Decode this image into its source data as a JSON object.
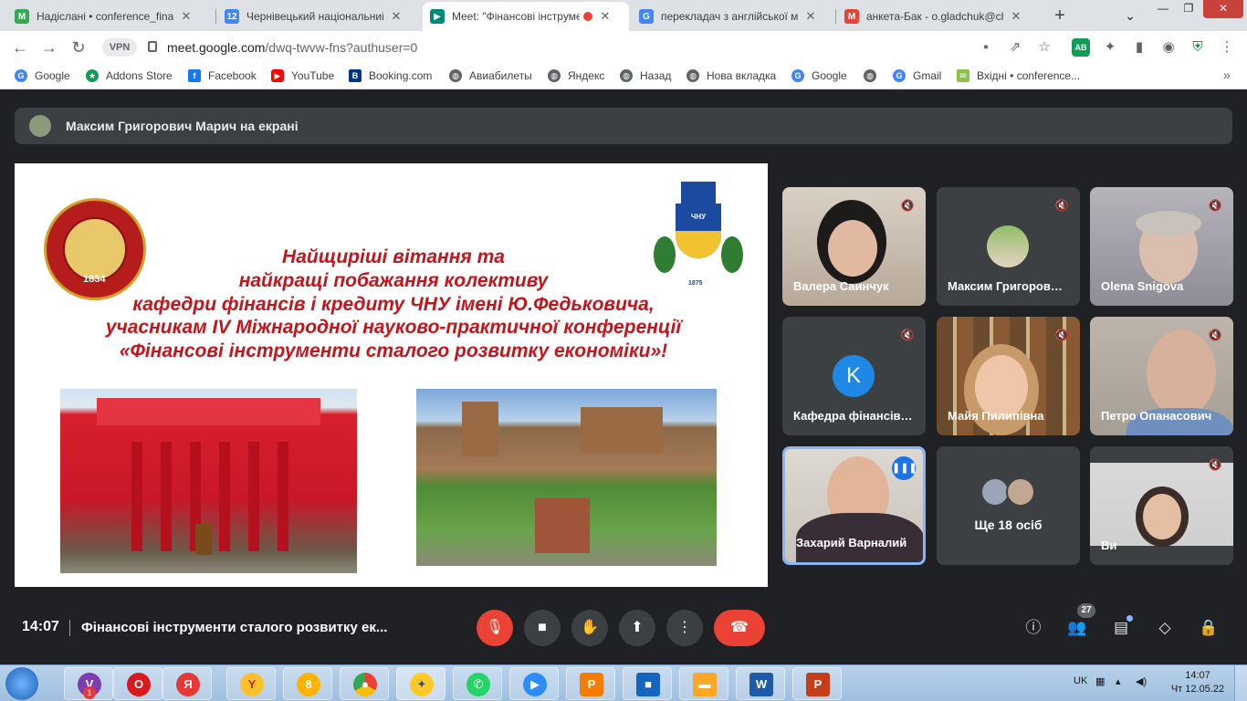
{
  "browser": {
    "tabs": [
      {
        "title": "Надіслані • conference_finance",
        "favicon": "gmail-icon",
        "color": "#34a853"
      },
      {
        "title": "Чернівецький національний",
        "favicon": "calendar-icon",
        "color": "#4285f4"
      },
      {
        "title": "Meet: \"Фінансові інструменти",
        "favicon": "meet-icon",
        "color": "#00897b",
        "active": true
      },
      {
        "title": "перекладач з англійської мови",
        "favicon": "google-icon",
        "color": "#4285f4"
      },
      {
        "title": "анкета-Бак - o.gladchuk@chnu",
        "favicon": "gmail-icon",
        "color": "#ea4335"
      }
    ],
    "new_tab": "+",
    "chevron": "⌄",
    "window_controls": [
      "—",
      "❐",
      "✕"
    ],
    "vpn_label": "VPN",
    "url_host": "meet.google.com",
    "url_path": "/dwq-twvw-fns?authuser=0",
    "bookmarks": [
      {
        "label": "Google",
        "icon": "google-icon",
        "color": "#4285f4"
      },
      {
        "label": "Addons Store",
        "icon": "addons-store-icon",
        "color": "#0f9d58"
      },
      {
        "label": "Facebook",
        "icon": "facebook-icon",
        "color": "#1877f2"
      },
      {
        "label": "YouTube",
        "icon": "youtube-icon",
        "color": "#ff0000"
      },
      {
        "label": "Booking.com",
        "icon": "booking-icon",
        "color": "#003580"
      },
      {
        "label": "Авиабилеты",
        "icon": "globe-icon",
        "color": "#5f6368"
      },
      {
        "label": "Яндекс",
        "icon": "globe-icon",
        "color": "#5f6368"
      },
      {
        "label": "Назад",
        "icon": "globe-icon",
        "color": "#5f6368"
      },
      {
        "label": "Нова вкладка",
        "icon": "globe-icon",
        "color": "#5f6368"
      },
      {
        "label": "Google",
        "icon": "google-icon",
        "color": "#4285f4"
      },
      {
        "label": "",
        "icon": "globe-icon",
        "color": "#5f6368"
      },
      {
        "label": "Gmail",
        "icon": "google-icon",
        "color": "#4285f4"
      },
      {
        "label": "Вхідні • conference...",
        "icon": "inbox-icon",
        "color": "#8bc34a"
      }
    ],
    "bookmarks_more": "»"
  },
  "meet": {
    "presenting_text": "Максим Григорович Марич на екрані",
    "slide": {
      "title_lines": [
        "Найщиріші вітання та",
        "найкращі побажання колективу",
        "кафедри фінансів і кредиту ЧНУ імені Ю.Федьковича,",
        "учасникам IV Міжнародної науково-практичної конференції",
        "«Фінансові інструменти сталого розвитку економіки»!"
      ],
      "seal_year": "1834",
      "crest_text": "ЧНУ",
      "crest_year": "1875"
    },
    "participants": [
      {
        "name": "Валера Саинчук",
        "muted": true
      },
      {
        "name": "Максим Григорович Марич",
        "muted": true
      },
      {
        "name": "Olena Snigova",
        "muted": true
      },
      {
        "name": "Кафедра фінансів і кредиту",
        "muted": true,
        "initial": "K"
      },
      {
        "name": "Майя Пилипівна",
        "muted": true
      },
      {
        "name": "Петро Опанасович",
        "muted": true
      },
      {
        "name": "Захарий Варналий",
        "speaking": true
      },
      {
        "name": "Ще 18 осіб",
        "more": true
      },
      {
        "name": "Ви",
        "muted": true
      }
    ],
    "time": "14:07",
    "meeting_name": "Фінансові інструменти сталого розвитку ек...",
    "participant_count": "27",
    "glyphs": {
      "mic_off": "🎙",
      "camera": "■",
      "hand": "✋",
      "present": "⬆",
      "more": "⋮",
      "end": "☎",
      "info": "ⓘ",
      "people": "👥",
      "chat": "▤",
      "activities": "◇",
      "lock": "🔒",
      "muted": "🔇",
      "speaking": "❚❚❚"
    }
  },
  "taskbar": {
    "apps": [
      {
        "name": "viber",
        "color": "#7d3daf",
        "glyph": "V"
      },
      {
        "name": "opera",
        "color": "#d71920",
        "glyph": "O"
      },
      {
        "name": "yandex",
        "color": "#e53935",
        "glyph": "Я"
      },
      {
        "name": "yandex-browser",
        "color": "#fbc02d",
        "glyph": "Y"
      },
      {
        "name": "bookmate",
        "color": "#ffb300",
        "glyph": "8"
      },
      {
        "name": "chrome",
        "color": "#34a853",
        "glyph": "●"
      },
      {
        "name": "security",
        "color": "#ffca28",
        "glyph": "✦"
      },
      {
        "name": "whatsapp",
        "color": "#25d366",
        "glyph": "✆"
      },
      {
        "name": "zoom",
        "color": "#2d8cff",
        "glyph": "▶"
      },
      {
        "name": "pdf",
        "color": "#f57c00",
        "glyph": "P"
      },
      {
        "name": "virtualbox",
        "color": "#1565c0",
        "glyph": "■"
      },
      {
        "name": "explorer",
        "color": "#f9a825",
        "glyph": "▬"
      },
      {
        "name": "word",
        "color": "#1e5aa8",
        "glyph": "W"
      },
      {
        "name": "powerpoint",
        "color": "#c43e1c",
        "glyph": "P"
      }
    ],
    "viber_badge": "1",
    "language": "UK",
    "time": "14:07",
    "date": "Чт 12.05.22"
  }
}
